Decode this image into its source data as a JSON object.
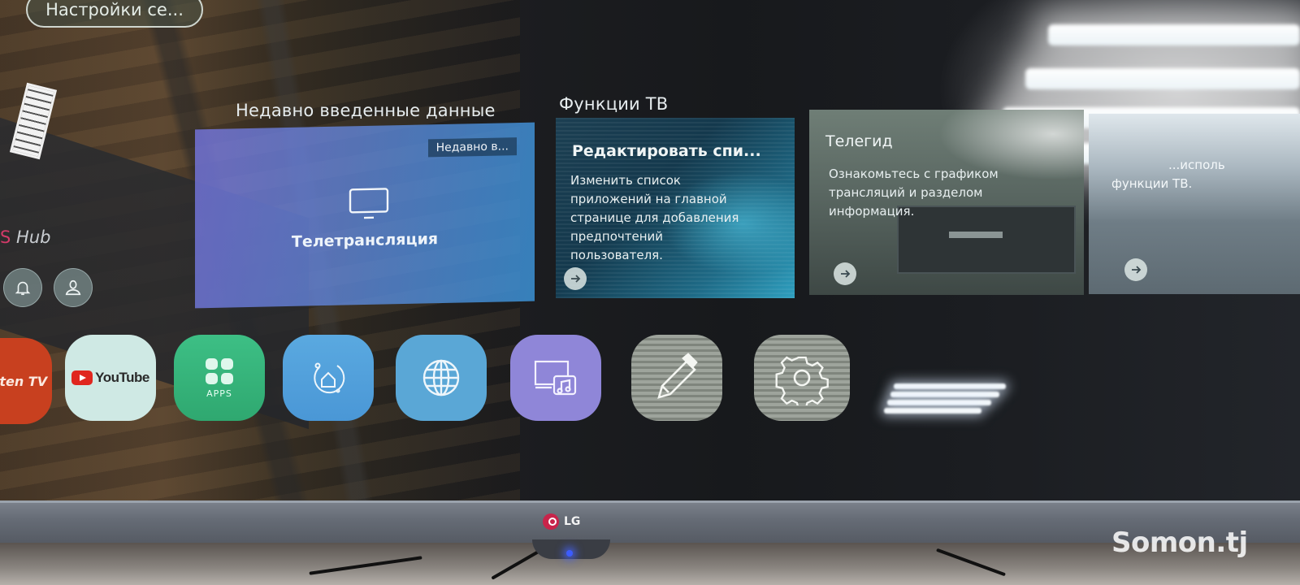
{
  "top_pill": {
    "label": "Настройки се..."
  },
  "hub": {
    "logo_prefix": "S",
    "logo_text": "Hub",
    "notification_icon": "bell-icon",
    "profile_icon": "user-icon"
  },
  "recent": {
    "section_title": "Недавно введенные данные",
    "badge": "Недавно в...",
    "item_icon": "tv-icon",
    "item_label": "Телетрансляция"
  },
  "tv_functions": {
    "section_title": "Функции ТВ",
    "cards": [
      {
        "title": "Редактировать спи...",
        "description_lines": [
          "Изменить список",
          "приложений на главной",
          "странице для добавления",
          "предпочтений",
          "пользователя."
        ],
        "action_icon": "arrow-right-icon"
      },
      {
        "title": "Телегид",
        "description_lines": [
          "Ознакомьтесь с графиком",
          "трансляций и разделом",
          "информация."
        ],
        "action_icon": "arrow-right-icon"
      },
      {
        "title": "",
        "description_lines": [
          "...исполь",
          "функции ТВ."
        ],
        "action_icon": "arrow-right-icon"
      }
    ]
  },
  "launcher": {
    "apps": [
      {
        "name": "Rakuten TV",
        "label": "uten TV",
        "color": "#c8401f"
      },
      {
        "name": "YouTube",
        "label": "YouTube",
        "color": "#cfe9e4"
      },
      {
        "name": "Apps",
        "label": "APPS",
        "color": "#3dbf85"
      },
      {
        "name": "Home Dashboard",
        "icon": "home-sync-icon",
        "color": "#5aa9e0"
      },
      {
        "name": "Web Browser",
        "icon": "globe-icon",
        "color": "#5aa7d6"
      },
      {
        "name": "Media Player",
        "icon": "media-music-icon",
        "color": "#8f86d8"
      },
      {
        "name": "Edit",
        "icon": "pencil-icon",
        "color": "#9ea49c"
      },
      {
        "name": "Settings",
        "icon": "gear-icon",
        "color": "#9ea49c"
      }
    ]
  },
  "device": {
    "brand": "LG",
    "power_led_color": "#3c5cff"
  },
  "watermark": "Somon.tj"
}
